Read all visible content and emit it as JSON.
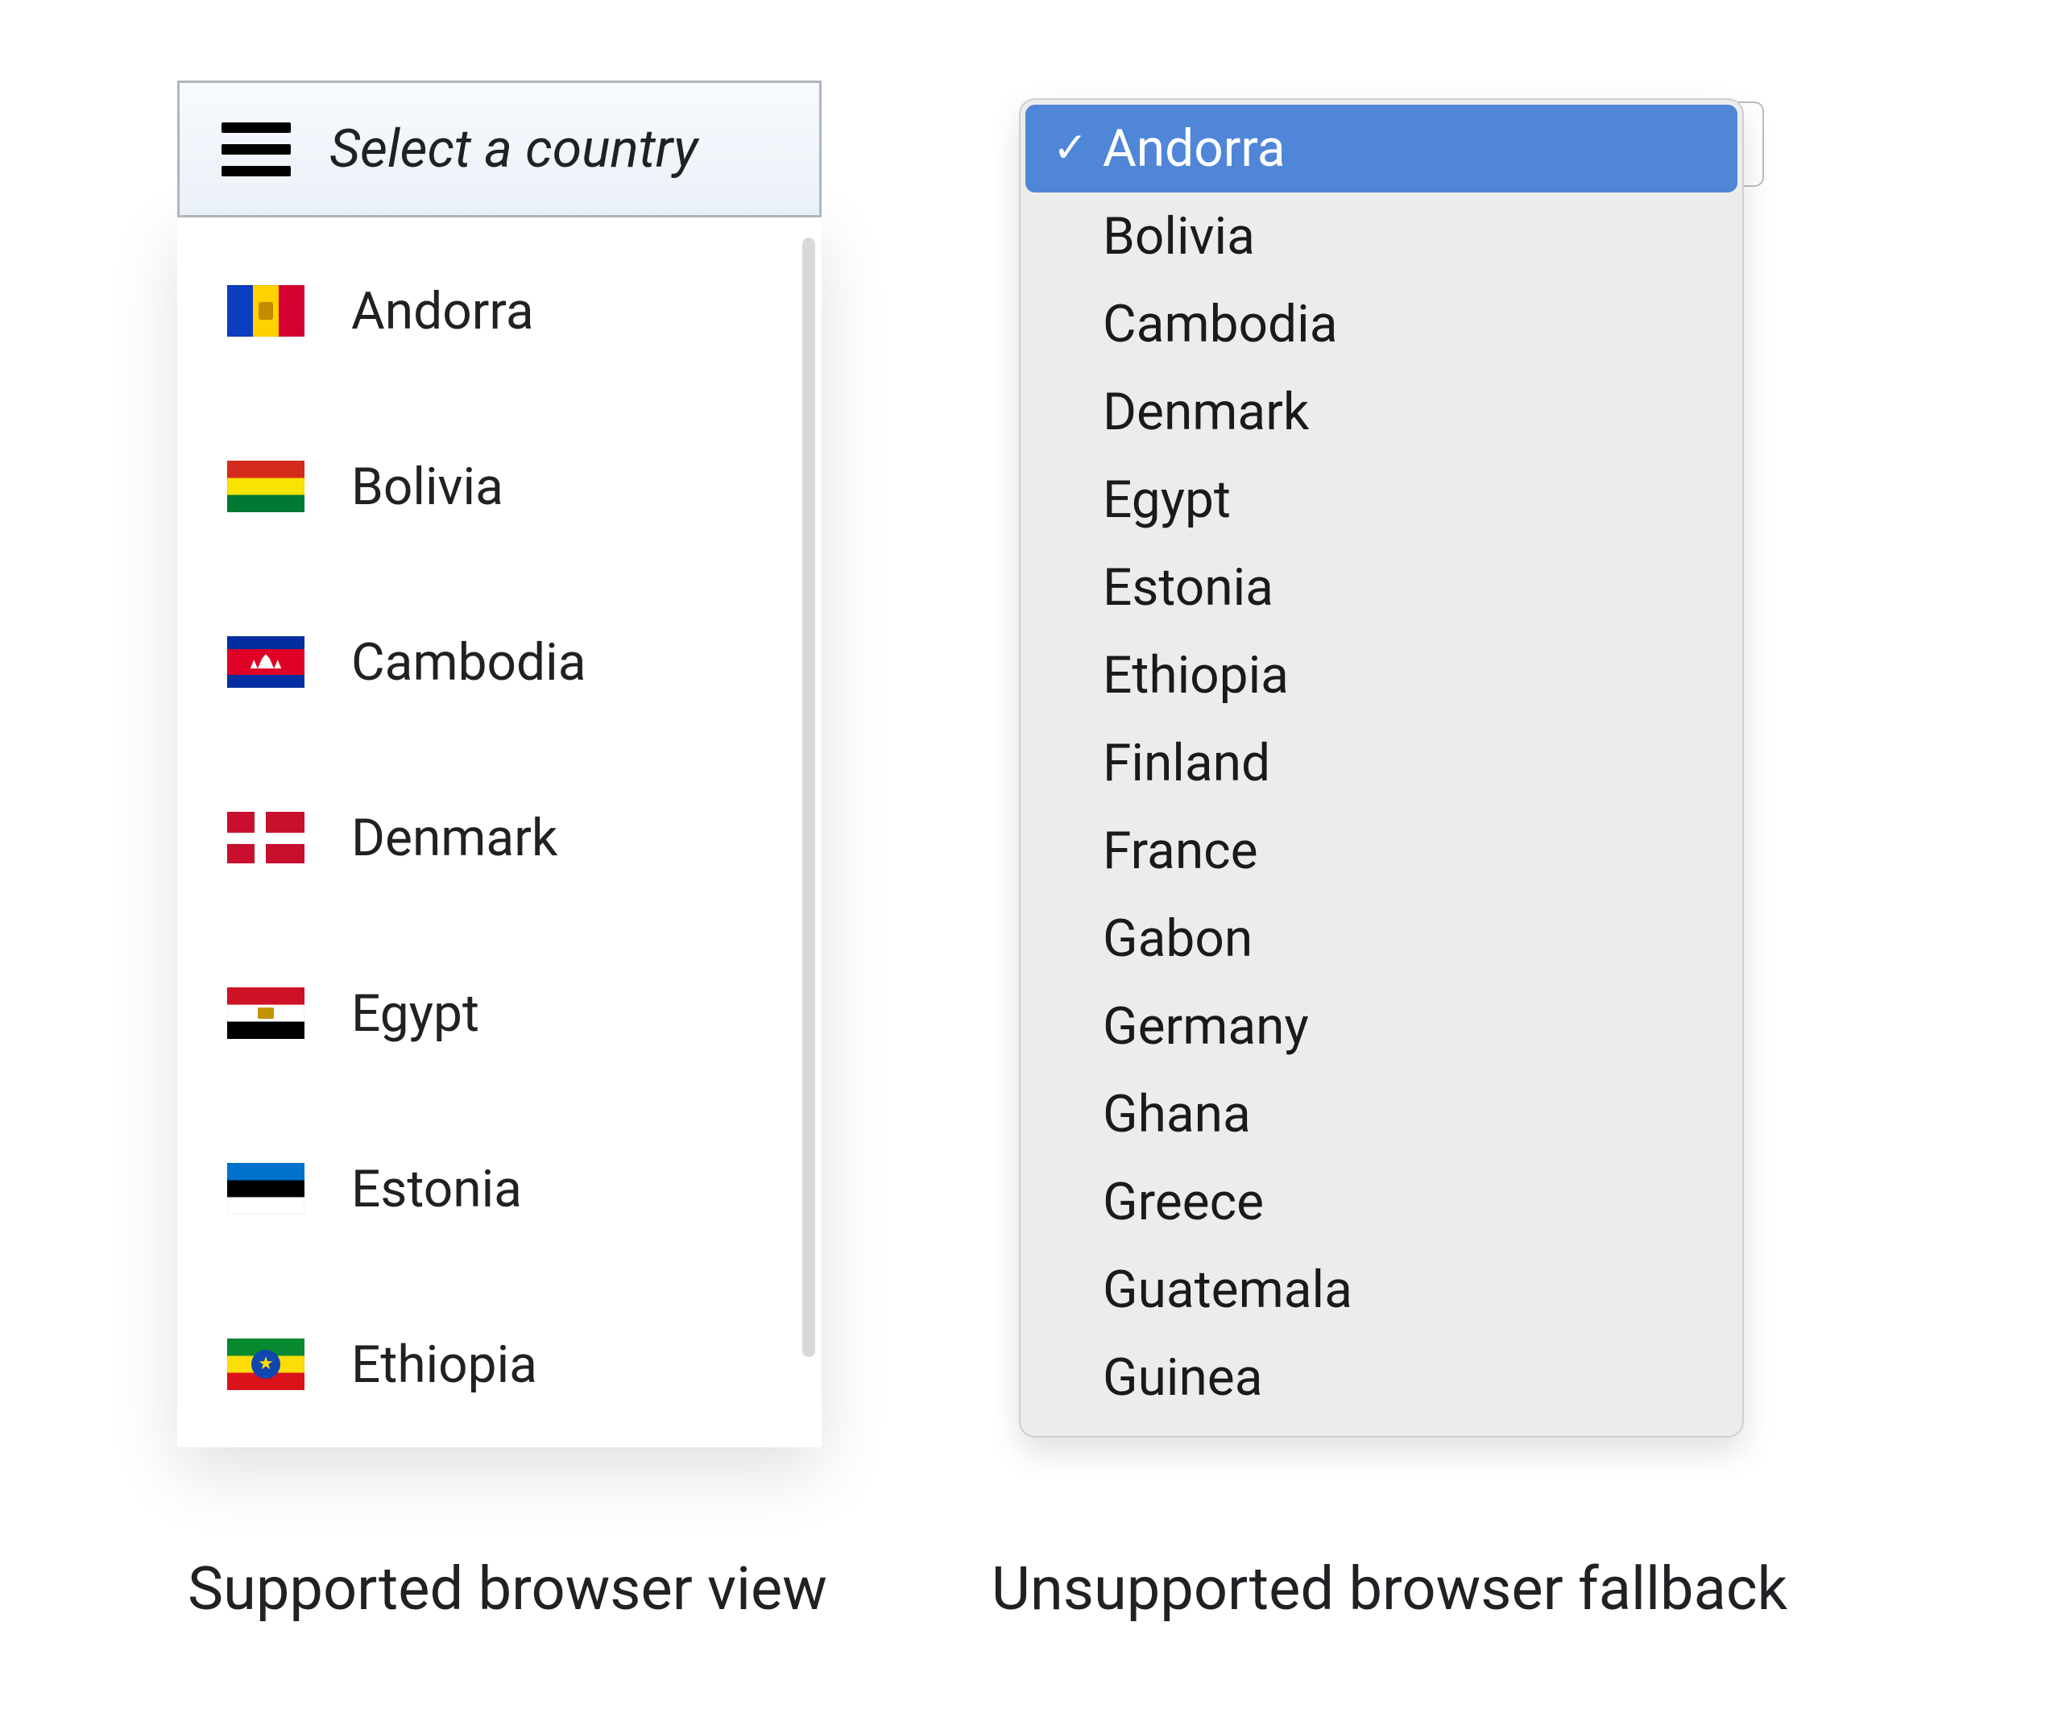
{
  "custom": {
    "button_label": "Select a country",
    "items": [
      {
        "name": "Andorra",
        "flag": "flag-andorra"
      },
      {
        "name": "Bolivia",
        "flag": "flag-bolivia"
      },
      {
        "name": "Cambodia",
        "flag": "flag-cambodia"
      },
      {
        "name": "Denmark",
        "flag": "flag-denmark"
      },
      {
        "name": "Egypt",
        "flag": "flag-egypt"
      },
      {
        "name": "Estonia",
        "flag": "flag-estonia"
      },
      {
        "name": "Ethiopia",
        "flag": "flag-ethiopia"
      }
    ]
  },
  "native": {
    "selected_index": 0,
    "items": [
      "Andorra",
      "Bolivia",
      "Cambodia",
      "Denmark",
      "Egypt",
      "Estonia",
      "Ethiopia",
      "Finland",
      "France",
      "Gabon",
      "Germany",
      "Ghana",
      "Greece",
      "Guatemala",
      "Guinea"
    ]
  },
  "captions": {
    "left": "Supported browser view",
    "right": "Unsupported browser fallback"
  },
  "icons": {
    "hamburger": "hamburger-icon",
    "check": "✓"
  },
  "colors": {
    "highlight": "#4f86d8"
  }
}
